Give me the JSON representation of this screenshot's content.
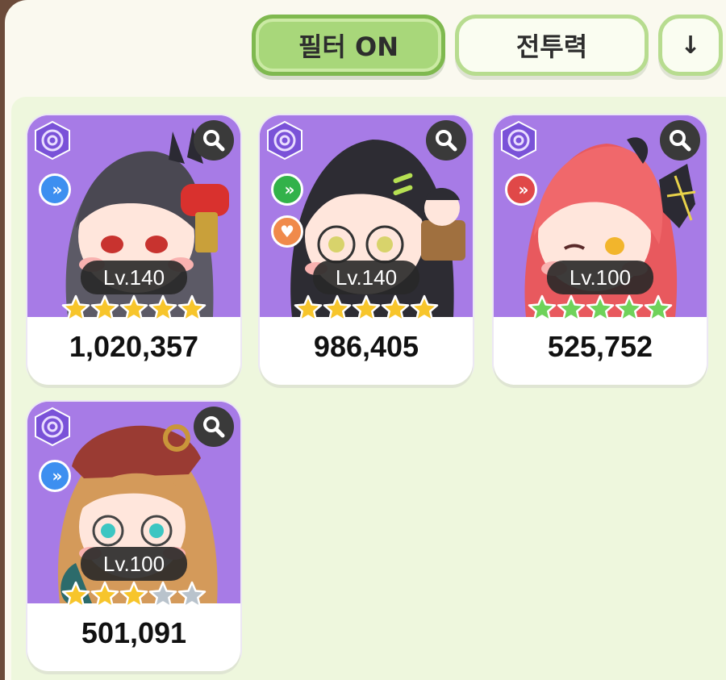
{
  "toolbar": {
    "filter_label": "필터 ON",
    "sort_label": "전투력",
    "order_label": "↓"
  },
  "cards": [
    {
      "level": "Lv.140",
      "power": "1,020,357",
      "stars_filled": 5,
      "stars_total": 5,
      "star_color": "gold",
      "role": "blue-chevron",
      "has_extra": false
    },
    {
      "level": "Lv.140",
      "power": "986,405",
      "stars_filled": 5,
      "stars_total": 5,
      "star_color": "gold",
      "role": "green-chevron",
      "has_extra": true
    },
    {
      "level": "Lv.100",
      "power": "525,752",
      "stars_filled": 5,
      "stars_total": 5,
      "star_color": "green",
      "role": "red-chevron",
      "has_extra": false
    },
    {
      "level": "Lv.100",
      "power": "501,091",
      "stars_filled": 3,
      "stars_total": 5,
      "star_color": "gold",
      "role": "blue-chevron",
      "has_extra": false
    }
  ],
  "colors": {
    "star_gold": "#f7c52b",
    "star_green": "#6fd25a",
    "star_empty": "#b9c3cc",
    "role_blue": "#3d8ff0",
    "role_green": "#32b24a",
    "role_red": "#e04848",
    "portrait_bg": "#a77be6"
  },
  "icons": {
    "element": "swirl-element-icon",
    "zoom": "magnifier-icon",
    "role": "chevron-double-icon",
    "extra": "heart-icon"
  }
}
